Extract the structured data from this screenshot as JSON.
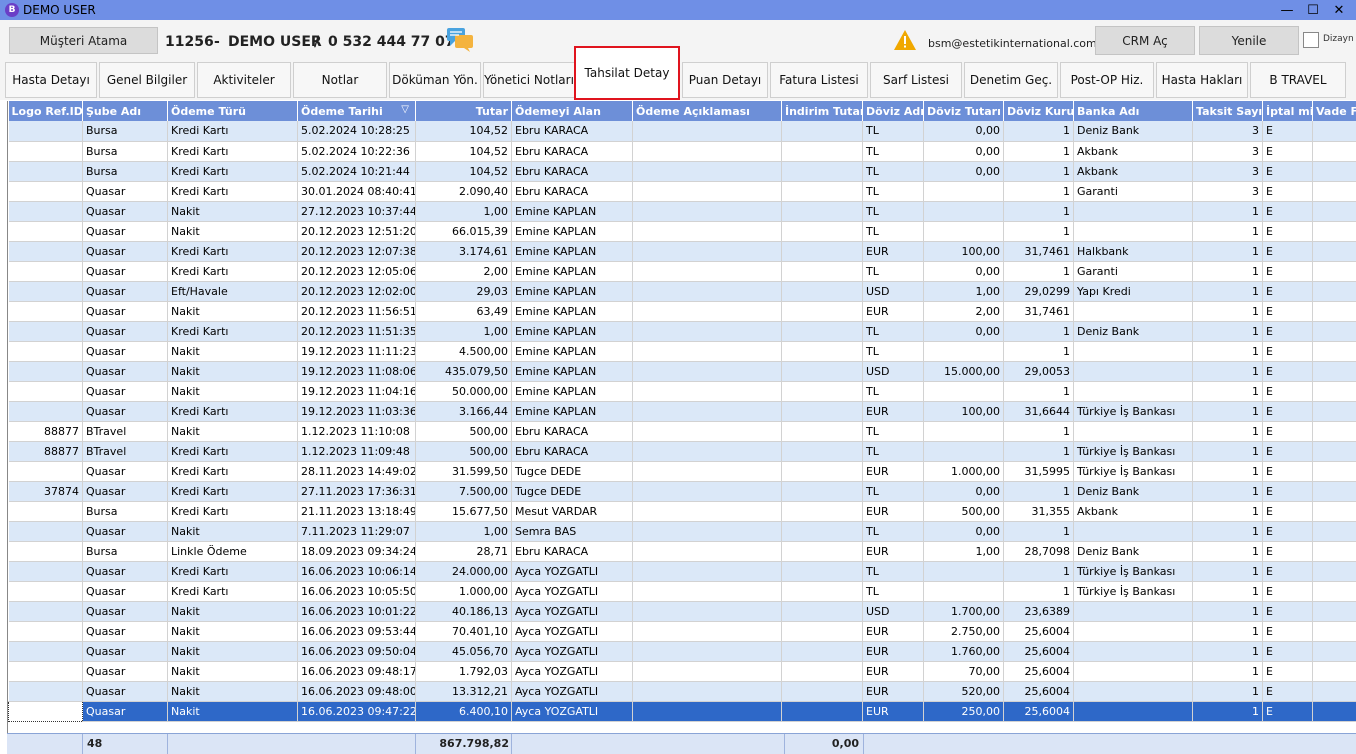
{
  "window": {
    "title": "DEMO USER",
    "icon_letter": "B"
  },
  "header": {
    "assign_button": "Müşteri Atama",
    "patient_id": "11256",
    "dash": "-",
    "patient_name": "DEMO USER",
    "slash": "/",
    "phone": "0 532 444 77 07",
    "email": "bsm@estetikinternational.com",
    "crm_button": "CRM Aç",
    "refresh_button": "Yenile",
    "design_label": "Dizayn"
  },
  "tabs": [
    {
      "label": "Hasta Detayı"
    },
    {
      "label": "Genel Bilgiler"
    },
    {
      "label": "Aktiviteler"
    },
    {
      "label": "Notlar"
    },
    {
      "label": "Döküman Yön."
    },
    {
      "label": "Yönetici Notları"
    },
    {
      "label": "Tahsilat Detay",
      "active": true
    },
    {
      "label": "Puan Detayı"
    },
    {
      "label": "Fatura Listesi"
    },
    {
      "label": "Sarf Listesi"
    },
    {
      "label": "Denetim Geç."
    },
    {
      "label": "Post-OP Hiz."
    },
    {
      "label": "Hasta Hakları"
    },
    {
      "label": "B TRAVEL"
    }
  ],
  "grid": {
    "columns": [
      "Logo Ref.ID",
      "Şube Adı",
      "Ödeme Türü",
      "Ödeme Tarihi",
      "Tutar",
      "Ödemeyi Alan",
      "Ödeme Açıklaması",
      "İndirim Tutarı",
      "Döviz Adı",
      "Döviz Tutarı",
      "Döviz Kuru",
      "Banka Adı",
      "Taksit Sayısı",
      "İptal mi?",
      "Vade Farkı"
    ],
    "sort_indicator": "▽",
    "rows": [
      [
        "",
        "Bursa",
        "Kredi Kartı",
        "5.02.2024 10:28:25",
        "104,52",
        "Ebru KARACA",
        "",
        "",
        "TL",
        "0,00",
        "1",
        "Deniz Bank",
        "3",
        "E",
        ""
      ],
      [
        "",
        "Bursa",
        "Kredi Kartı",
        "5.02.2024 10:22:36",
        "104,52",
        "Ebru KARACA",
        "",
        "",
        "TL",
        "0,00",
        "1",
        "Akbank",
        "3",
        "E",
        ""
      ],
      [
        "",
        "Bursa",
        "Kredi Kartı",
        "5.02.2024 10:21:44",
        "104,52",
        "Ebru KARACA",
        "",
        "",
        "TL",
        "0,00",
        "1",
        "Akbank",
        "3",
        "E",
        ""
      ],
      [
        "",
        "Quasar",
        "Kredi Kartı",
        "30.01.2024 08:40:41",
        "2.090,40",
        "Ebru KARACA",
        "",
        "",
        "TL",
        "",
        "1",
        "Garanti",
        "3",
        "E",
        ""
      ],
      [
        "",
        "Quasar",
        "Nakit",
        "27.12.2023 10:37:44",
        "1,00",
        "Emine KAPLAN",
        "",
        "",
        "TL",
        "",
        "1",
        "",
        "1",
        "E",
        ""
      ],
      [
        "",
        "Quasar",
        "Nakit",
        "20.12.2023 12:51:20",
        "66.015,39",
        "Emine KAPLAN",
        "",
        "",
        "TL",
        "",
        "1",
        "",
        "1",
        "E",
        ""
      ],
      [
        "",
        "Quasar",
        "Kredi Kartı",
        "20.12.2023 12:07:38",
        "3.174,61",
        "Emine KAPLAN",
        "",
        "",
        "EUR",
        "100,00",
        "31,7461",
        "Halkbank",
        "1",
        "E",
        ""
      ],
      [
        "",
        "Quasar",
        "Kredi Kartı",
        "20.12.2023 12:05:06",
        "2,00",
        "Emine KAPLAN",
        "",
        "",
        "TL",
        "0,00",
        "1",
        "Garanti",
        "1",
        "E",
        ""
      ],
      [
        "",
        "Quasar",
        "Eft/Havale",
        "20.12.2023 12:02:00",
        "29,03",
        "Emine KAPLAN",
        "",
        "",
        "USD",
        "1,00",
        "29,0299",
        "Yapı Kredi",
        "1",
        "E",
        ""
      ],
      [
        "",
        "Quasar",
        "Nakit",
        "20.12.2023 11:56:51",
        "63,49",
        "Emine KAPLAN",
        "",
        "",
        "EUR",
        "2,00",
        "31,7461",
        "",
        "1",
        "E",
        ""
      ],
      [
        "",
        "Quasar",
        "Kredi Kartı",
        "20.12.2023 11:51:35",
        "1,00",
        "Emine KAPLAN",
        "",
        "",
        "TL",
        "0,00",
        "1",
        "Deniz Bank",
        "1",
        "E",
        ""
      ],
      [
        "",
        "Quasar",
        "Nakit",
        "19.12.2023 11:11:23",
        "4.500,00",
        "Emine KAPLAN",
        "",
        "",
        "TL",
        "",
        "1",
        "",
        "1",
        "E",
        ""
      ],
      [
        "",
        "Quasar",
        "Nakit",
        "19.12.2023 11:08:06",
        "435.079,50",
        "Emine KAPLAN",
        "",
        "",
        "USD",
        "15.000,00",
        "29,0053",
        "",
        "1",
        "E",
        ""
      ],
      [
        "",
        "Quasar",
        "Nakit",
        "19.12.2023 11:04:16",
        "50.000,00",
        "Emine KAPLAN",
        "",
        "",
        "TL",
        "",
        "1",
        "",
        "1",
        "E",
        ""
      ],
      [
        "",
        "Quasar",
        "Kredi Kartı",
        "19.12.2023 11:03:36",
        "3.166,44",
        "Emine KAPLAN",
        "",
        "",
        "EUR",
        "100,00",
        "31,6644",
        "Türkiye İş Bankası",
        "1",
        "E",
        ""
      ],
      [
        "88877",
        "BTravel",
        "Nakit",
        "1.12.2023 11:10:08",
        "500,00",
        "Ebru KARACA",
        "",
        "",
        "TL",
        "",
        "1",
        "",
        "1",
        "E",
        ""
      ],
      [
        "88877",
        "BTravel",
        "Kredi Kartı",
        "1.12.2023 11:09:48",
        "500,00",
        "Ebru KARACA",
        "",
        "",
        "TL",
        "",
        "1",
        "Türkiye İş Bankası",
        "1",
        "E",
        ""
      ],
      [
        "",
        "Quasar",
        "Kredi Kartı",
        "28.11.2023 14:49:02",
        "31.599,50",
        "Tugce DEDE",
        "",
        "",
        "EUR",
        "1.000,00",
        "31,5995",
        "Türkiye İş Bankası",
        "1",
        "E",
        ""
      ],
      [
        "37874",
        "Quasar",
        "Kredi Kartı",
        "27.11.2023 17:36:31",
        "7.500,00",
        "Tugce DEDE",
        "",
        "",
        "TL",
        "0,00",
        "1",
        "Deniz Bank",
        "1",
        "E",
        ""
      ],
      [
        "",
        "Bursa",
        "Kredi Kartı",
        "21.11.2023 13:18:49",
        "15.677,50",
        "Mesut VARDAR",
        "",
        "",
        "EUR",
        "500,00",
        "31,355",
        "Akbank",
        "1",
        "E",
        ""
      ],
      [
        "",
        "Quasar",
        "Nakit",
        "7.11.2023 11:29:07",
        "1,00",
        "Semra BAS",
        "",
        "",
        "TL",
        "0,00",
        "1",
        "",
        "1",
        "E",
        ""
      ],
      [
        "",
        "Bursa",
        "Linkle Ödeme",
        "18.09.2023 09:34:24",
        "28,71",
        "Ebru KARACA",
        "",
        "",
        "EUR",
        "1,00",
        "28,7098",
        "Deniz Bank",
        "1",
        "E",
        ""
      ],
      [
        "",
        "Quasar",
        "Kredi Kartı",
        "16.06.2023 10:06:14",
        "24.000,00",
        "Ayca YOZGATLI",
        "",
        "",
        "TL",
        "",
        "1",
        "Türkiye İş Bankası",
        "1",
        "E",
        ""
      ],
      [
        "",
        "Quasar",
        "Kredi Kartı",
        "16.06.2023 10:05:50",
        "1.000,00",
        "Ayca YOZGATLI",
        "",
        "",
        "TL",
        "",
        "1",
        "Türkiye İş Bankası",
        "1",
        "E",
        ""
      ],
      [
        "",
        "Quasar",
        "Nakit",
        "16.06.2023 10:01:22",
        "40.186,13",
        "Ayca YOZGATLI",
        "",
        "",
        "USD",
        "1.700,00",
        "23,6389",
        "",
        "1",
        "E",
        ""
      ],
      [
        "",
        "Quasar",
        "Nakit",
        "16.06.2023 09:53:44",
        "70.401,10",
        "Ayca YOZGATLI",
        "",
        "",
        "EUR",
        "2.750,00",
        "25,6004",
        "",
        "1",
        "E",
        ""
      ],
      [
        "",
        "Quasar",
        "Nakit",
        "16.06.2023 09:50:04",
        "45.056,70",
        "Ayca YOZGATLI",
        "",
        "",
        "EUR",
        "1.760,00",
        "25,6004",
        "",
        "1",
        "E",
        ""
      ],
      [
        "",
        "Quasar",
        "Nakit",
        "16.06.2023 09:48:17",
        "1.792,03",
        "Ayca YOZGATLI",
        "",
        "",
        "EUR",
        "70,00",
        "25,6004",
        "",
        "1",
        "E",
        ""
      ],
      [
        "",
        "Quasar",
        "Nakit",
        "16.06.2023 09:48:00",
        "13.312,21",
        "Ayca YOZGATLI",
        "",
        "",
        "EUR",
        "520,00",
        "25,6004",
        "",
        "1",
        "E",
        ""
      ],
      [
        "",
        "Quasar",
        "Nakit",
        "16.06.2023 09:47:22",
        "6.400,10",
        "Ayca YOZGATLI",
        "",
        "",
        "EUR",
        "250,00",
        "25,6004",
        "",
        "1",
        "E",
        ""
      ]
    ],
    "selected_row": 29,
    "footer": {
      "count": "48",
      "total_amount": "867.798,82",
      "total_discount": "0,00"
    }
  }
}
